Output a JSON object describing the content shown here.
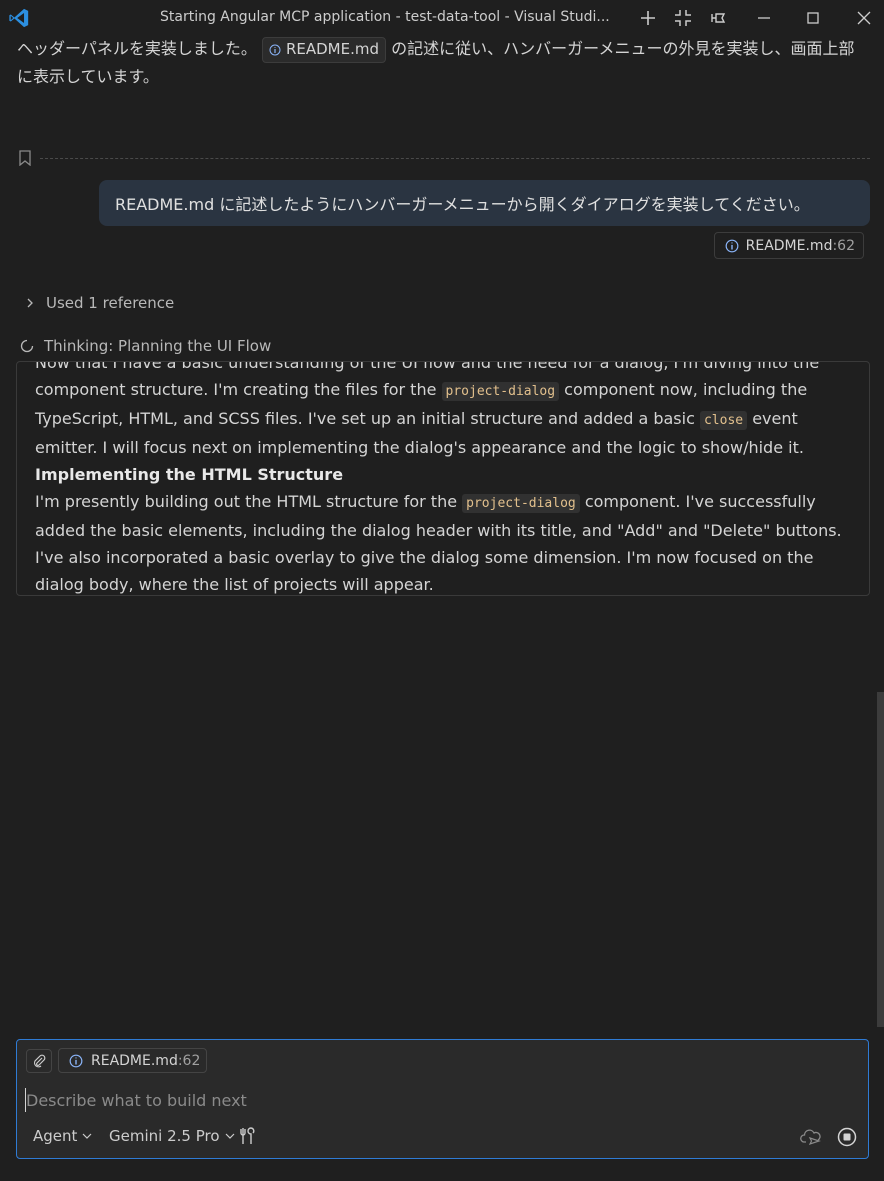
{
  "window": {
    "title": "Starting Angular MCP application - test-data-tool - Visual Studi..."
  },
  "prev_response": {
    "text_before": "ヘッダーパネルを実装しました。",
    "chip_label": "README.md",
    "text_after": "の記述に従い、ハンバーガーメニューの外見を実装し、画面上部に表示しています。"
  },
  "user_message": {
    "text": "README.md に記述したようにハンバーガーメニューから開くダイアログを実装してください。",
    "ref_file": "README.md",
    "ref_line": ":62"
  },
  "references": {
    "label": "Used 1 reference"
  },
  "thinking": {
    "label": "Thinking: Planning the UI Flow",
    "p1_partial": "Now that I have a basic understanding of the UI flow and the need for a dialog, I'm diving into the",
    "p1_a": "component structure. I'm creating the files for the ",
    "p1_code1": "project-dialog",
    "p1_b": " component now, including the TypeScript, HTML, and SCSS files. I've set up an initial structure and added a basic ",
    "p1_code2": "close",
    "p1_c": " event emitter. I will focus next on implementing the dialog's appearance and the logic to show/hide it.",
    "heading": "Implementing the HTML Structure",
    "p2_a": "I'm presently building out the HTML structure for the ",
    "p2_code": "project-dialog",
    "p2_b": " component. I've successfully added the basic elements, including the dialog header with its title, and \"Add\" and \"Delete\" buttons. I've also incorporated a basic overlay to give the dialog some dimension. I'm now focused on the dialog body, where the list of projects will appear."
  },
  "input": {
    "attach_file": "README.md",
    "attach_line": ":62",
    "placeholder": "Describe what to build next",
    "mode": "Agent",
    "model": "Gemini 2.5 Pro"
  },
  "colors": {
    "accent": "#2f7bd4",
    "code_text": "#e2c08d",
    "user_bubble": "#2a3441"
  }
}
